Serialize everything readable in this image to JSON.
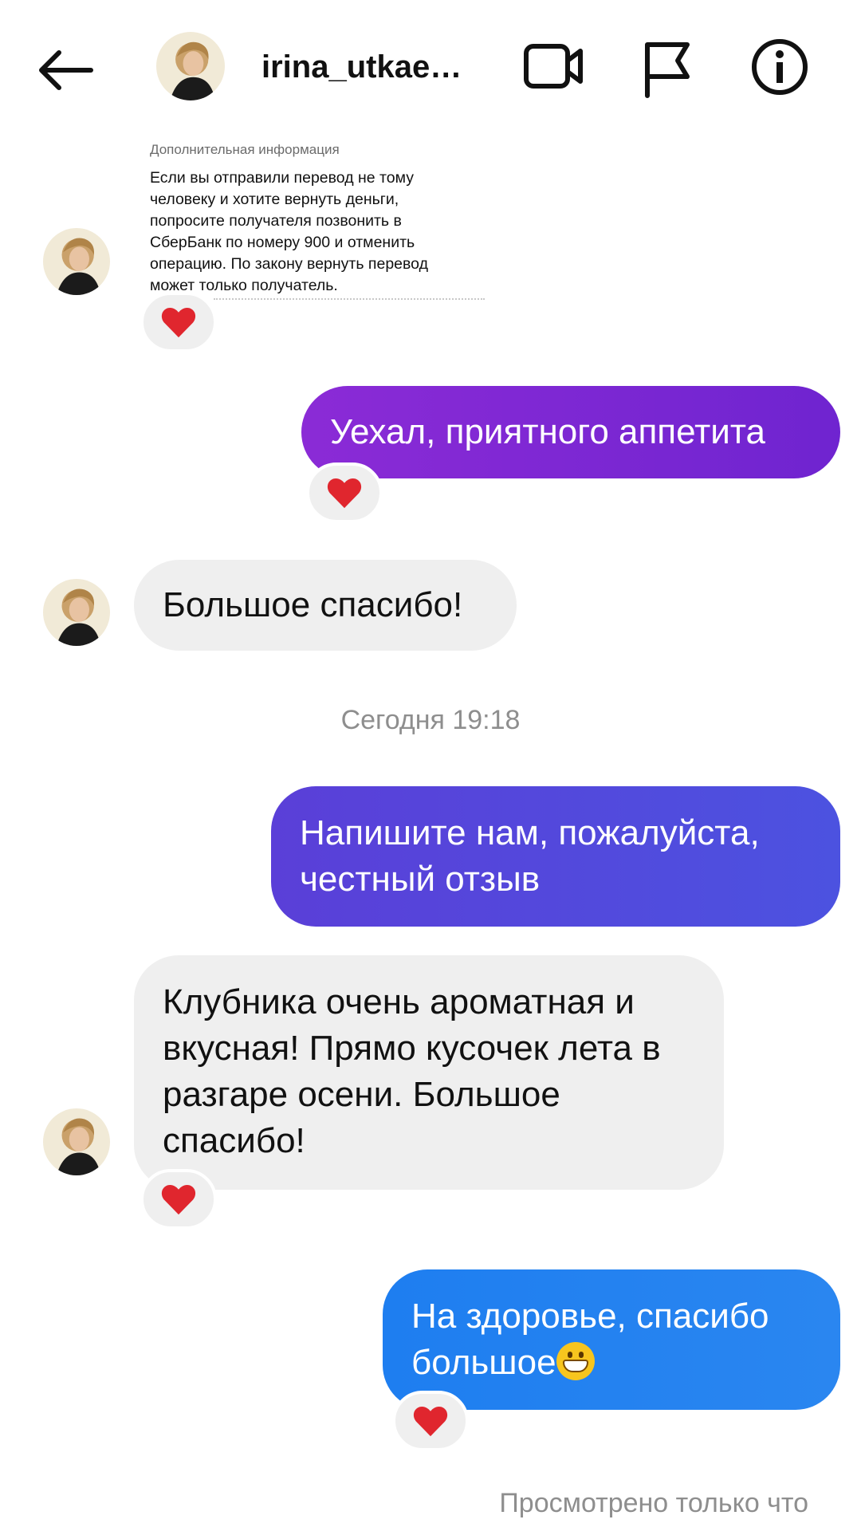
{
  "header": {
    "username": "irina_utkae…",
    "icons": [
      "back-arrow-icon",
      "video-call-icon",
      "report-flag-icon",
      "info-icon"
    ]
  },
  "messages": {
    "shared_card": {
      "label": "Дополнительная информация",
      "body": "Если вы отправили перевод не тому\nчеловеку и хотите вернуть деньги,\nпопросите получателя позвонить в\nСберБанк по номеру 900 и отменить\nоперацию. По закону вернуть перевод\nможет только получатель."
    },
    "out_1": "Уехал, приятного аппетита",
    "in_1": "Большое спасибо!",
    "timestamp": "Сегодня 19:18",
    "out_2": "Напишите нам, пожалуйста, честный отзыв",
    "in_2": "Клубника очень ароматная и вкусная! Прямо кусочек лета в разгаре осени. Большое спасибо!",
    "out_3": "На здоровье, спасибо большое",
    "out_3_emoji": "grinning-face-emoji",
    "seen_status": "Просмотрено только что"
  },
  "colors": {
    "bubble_purple": "#8b2bd6",
    "bubble_indigo": "#5a3fd8",
    "bubble_blue": "#1e7ef0",
    "bubble_incoming": "#efefef",
    "heart_red": "#e0262e",
    "muted_text": "#8e8e8e"
  }
}
